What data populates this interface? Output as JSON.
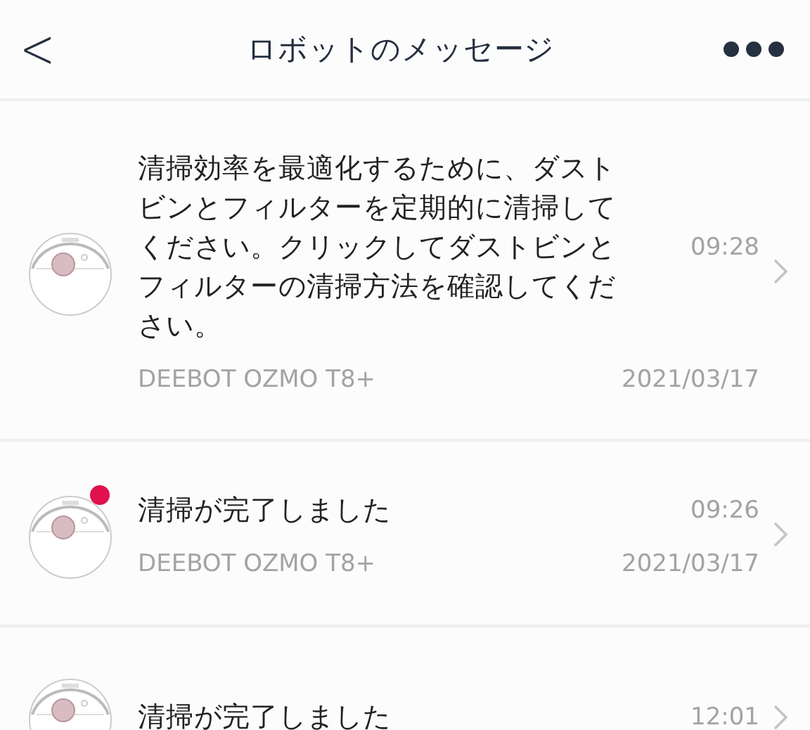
{
  "header": {
    "back": "<",
    "title": "ロボットのメッセージ"
  },
  "messages": [
    {
      "text": "清掃効率を最適化するために、ダストビンとフィルターを定期的に清掃してください。クリックしてダストビンとフィルターの清掃方法を確認してください。",
      "time": "09:28",
      "device": "DEEBOT OZMO T8+",
      "date": "2021/03/17",
      "unread": false
    },
    {
      "text": "清掃が完了しました",
      "time": "09:26",
      "device": "DEEBOT OZMO T8+",
      "date": "2021/03/17",
      "unread": true
    },
    {
      "text": "清掃が完了しました",
      "time": "12:01",
      "unread": false
    }
  ]
}
